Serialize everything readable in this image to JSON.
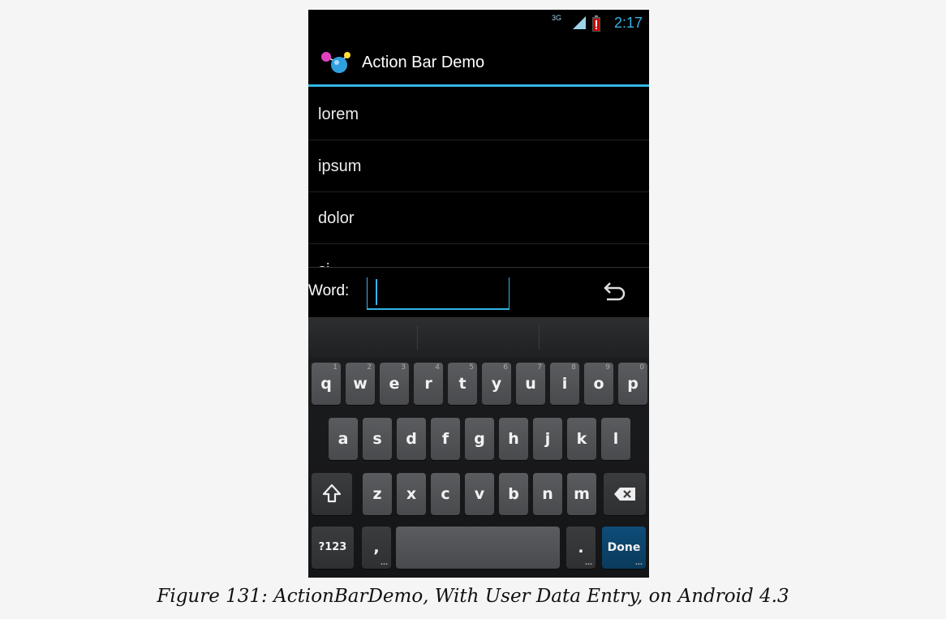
{
  "status_bar": {
    "network": "3G",
    "time": "2:17"
  },
  "action_bar": {
    "title": "Action Bar Demo",
    "icon": "app-molecule-icon"
  },
  "list": {
    "items": [
      "lorem",
      "ipsum",
      "dolor",
      "si"
    ]
  },
  "entry": {
    "label": "Word:",
    "value": "",
    "enter_icon": "enter-return-icon"
  },
  "keyboard": {
    "row1": [
      "q",
      "w",
      "e",
      "r",
      "t",
      "y",
      "u",
      "i",
      "o",
      "p"
    ],
    "row1_hints": [
      "1",
      "2",
      "3",
      "4",
      "5",
      "6",
      "7",
      "8",
      "9",
      "0"
    ],
    "row2": [
      "a",
      "s",
      "d",
      "f",
      "g",
      "h",
      "j",
      "k",
      "l"
    ],
    "row3": [
      "z",
      "x",
      "c",
      "v",
      "b",
      "n",
      "m"
    ],
    "shift_icon": "shift-arrow-icon",
    "delete_icon": "backspace-icon",
    "symbols_label": "?123",
    "comma_label": ",",
    "period_label": ".",
    "done_label": "Done"
  },
  "caption": "Figure 131: ActionBarDemo, With User Data Entry, on Android 4.3",
  "colors": {
    "accent": "#33b5e5",
    "done_key": "#0a3b5d",
    "battery_alert": "#cc0000"
  }
}
